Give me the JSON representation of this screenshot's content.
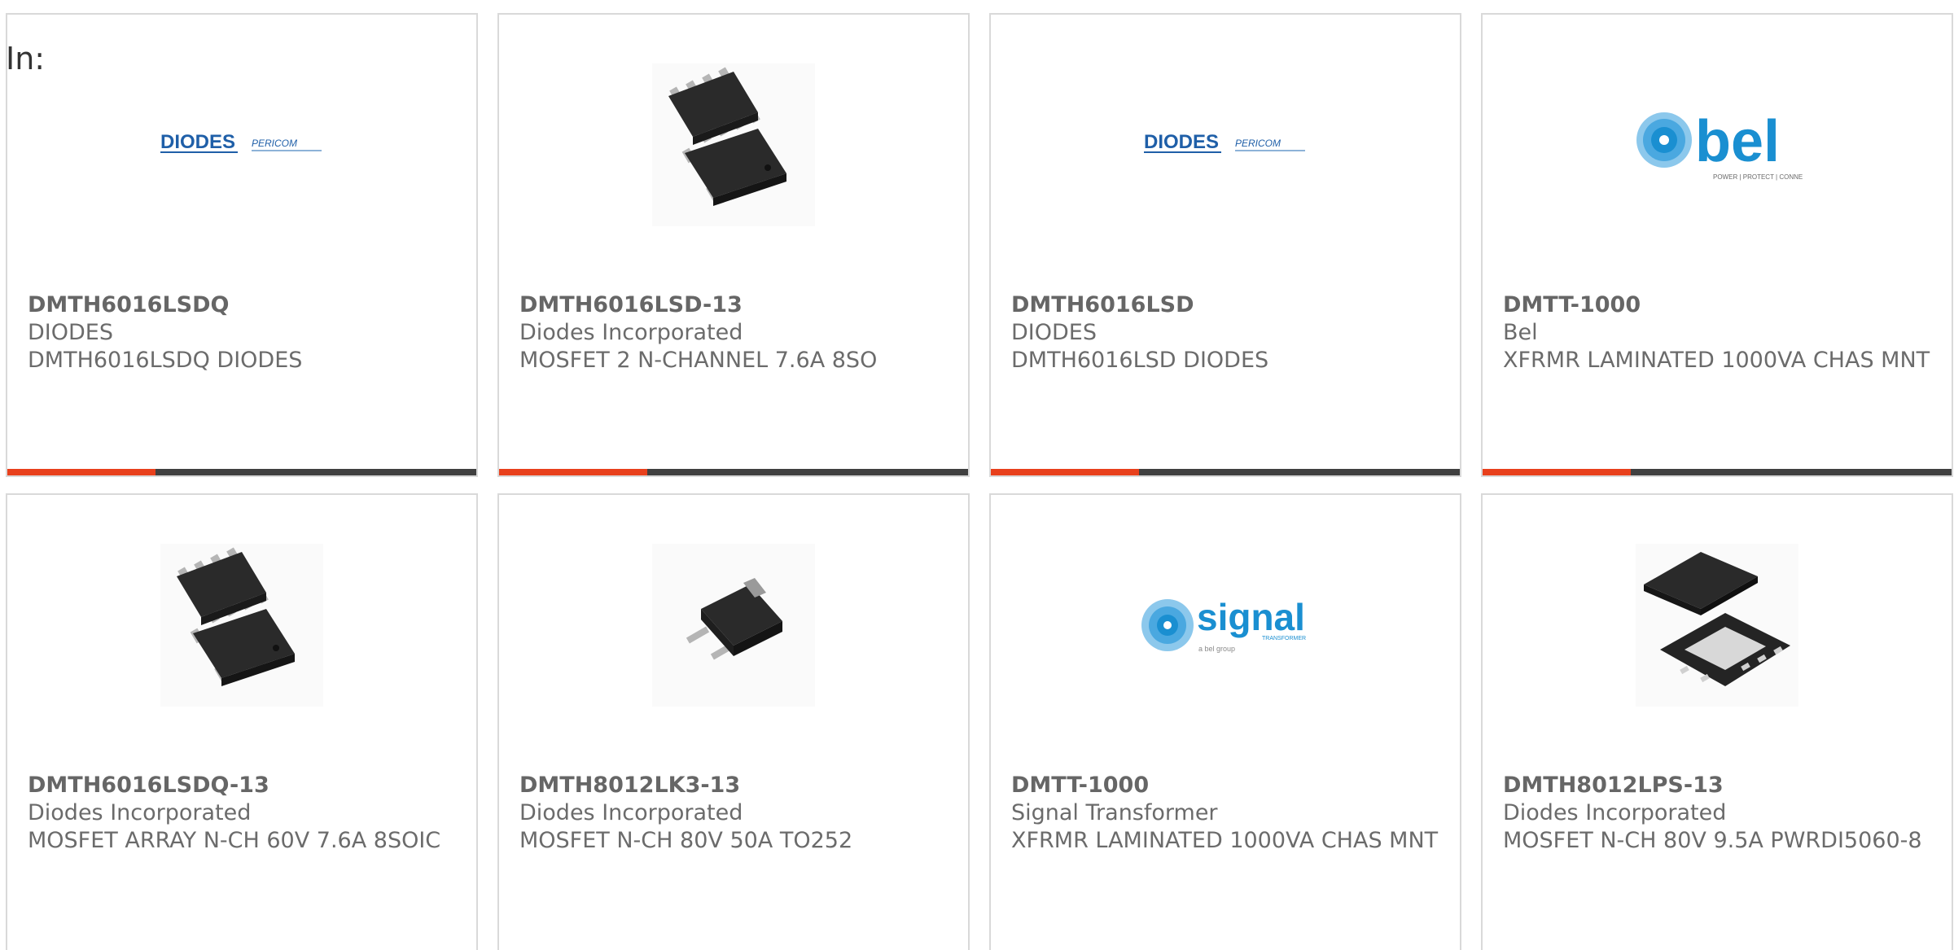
{
  "header": {
    "in_label": "In:"
  },
  "colors": {
    "accent": "#e8401c",
    "bar": "#404040",
    "diodes_blue": "#1f5fa8",
    "bel_blue": "#1a8fd1"
  },
  "products": [
    {
      "part": "DMTH6016LSDQ",
      "manufacturer": "DIODES",
      "description": "DMTH6016LSDQ DIODES",
      "image": "diodes-pericom-logo",
      "logo_text_1": "DIODES",
      "logo_text_2": "PERICOM"
    },
    {
      "part": "DMTH6016LSD-13",
      "manufacturer": "Diodes Incorporated",
      "description": "MOSFET 2 N-CHANNEL 7.6A 8SO",
      "image": "soic8-package"
    },
    {
      "part": "DMTH6016LSD",
      "manufacturer": "DIODES",
      "description": "DMTH6016LSD DIODES",
      "image": "diodes-pericom-logo",
      "logo_text_1": "DIODES",
      "logo_text_2": "PERICOM"
    },
    {
      "part": "DMTT-1000",
      "manufacturer": "Bel",
      "description": "XFRMR LAMINATED 1000VA CHAS MNT",
      "image": "bel-logo",
      "logo_text_1": "bel",
      "logo_text_2": "POWER | PROTECT | CONNECT"
    },
    {
      "part": "DMTH6016LSDQ-13",
      "manufacturer": "Diodes Incorporated",
      "description": "MOSFET ARRAY N-CH 60V 7.6A 8SOIC",
      "image": "soic8-package"
    },
    {
      "part": "DMTH8012LK3-13",
      "manufacturer": "Diodes Incorporated",
      "description": "MOSFET N-CH 80V 50A TO252",
      "image": "to252-package"
    },
    {
      "part": "DMTT-1000",
      "manufacturer": "Signal Transformer",
      "description": "XFRMR LAMINATED 1000VA CHAS MNT",
      "image": "signal-transformer-logo",
      "logo_text_1": "signal",
      "logo_text_2": "TRANSFORMER",
      "logo_text_3": "a bel group"
    },
    {
      "part": "DMTH8012LPS-13",
      "manufacturer": "Diodes Incorporated",
      "description": "MOSFET N-CH 80V 9.5A PWRDI5060-8",
      "image": "powerdi5060-package"
    }
  ]
}
